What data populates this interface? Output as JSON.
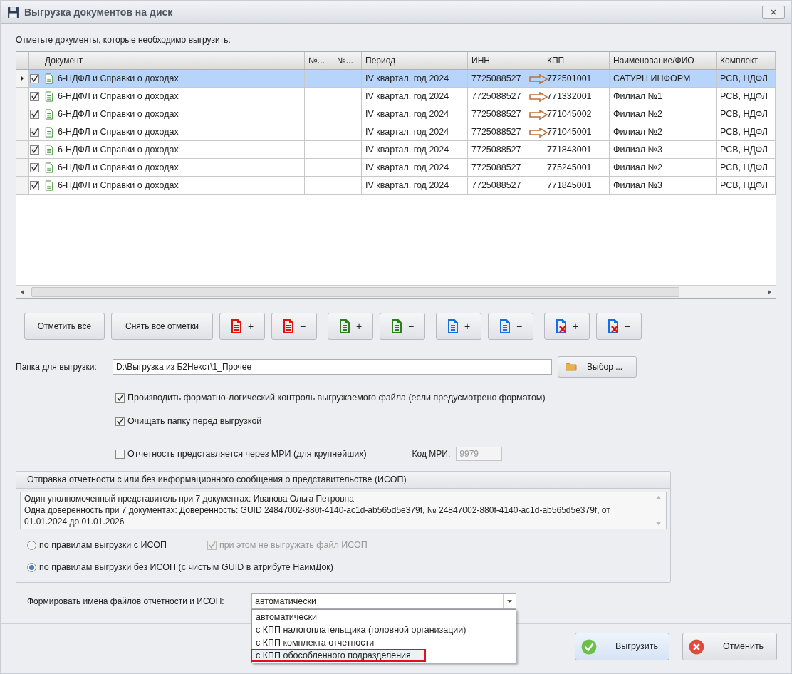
{
  "window": {
    "title": "Выгрузка документов на диск"
  },
  "prompt": "Отметьте документы, которые необходимо выгрузить:",
  "table": {
    "columns": [
      "Документ",
      "№...",
      "№...",
      "Период",
      "ИНН",
      "КПП",
      "Наименование/ФИО",
      "Комплект"
    ],
    "rows": [
      {
        "selected": true,
        "checked": true,
        "arrow": true,
        "cells": [
          "6-НДФЛ и Справки о доходах",
          "",
          "",
          "IV квартал, год 2024",
          "7725088527",
          "772501001",
          "САТУРН ИНФОРМ",
          "РСВ, НДФЛ"
        ]
      },
      {
        "selected": false,
        "checked": true,
        "arrow": true,
        "cells": [
          "6-НДФЛ и Справки о доходах",
          "",
          "",
          "IV квартал, год 2024",
          "7725088527",
          "771332001",
          "Филиал №1",
          "РСВ, НДФЛ"
        ]
      },
      {
        "selected": false,
        "checked": true,
        "arrow": true,
        "cells": [
          "6-НДФЛ и Справки о доходах",
          "",
          "",
          "IV квартал, год 2024",
          "7725088527",
          "771045002",
          "Филиал №2",
          "РСВ, НДФЛ"
        ]
      },
      {
        "selected": false,
        "checked": true,
        "arrow": true,
        "cells": [
          "6-НДФЛ и Справки о доходах",
          "",
          "",
          "IV квартал, год 2024",
          "7725088527",
          "771045001",
          "Филиал №2",
          "РСВ, НДФЛ"
        ]
      },
      {
        "selected": false,
        "checked": true,
        "arrow": false,
        "cells": [
          "6-НДФЛ и Справки о доходах",
          "",
          "",
          "IV квартал, год 2024",
          "7725088527",
          "771843001",
          "Филиал №3",
          "РСВ, НДФЛ"
        ]
      },
      {
        "selected": false,
        "checked": true,
        "arrow": false,
        "cells": [
          "6-НДФЛ и Справки о доходах",
          "",
          "",
          "IV квартал, год 2024",
          "7725088527",
          "775245001",
          "Филиал №2",
          "РСВ, НДФЛ"
        ]
      },
      {
        "selected": false,
        "checked": true,
        "arrow": false,
        "cells": [
          "6-НДФЛ и Справки о доходах",
          "",
          "",
          "IV квартал, год 2024",
          "7725088527",
          "771845001",
          "Филиал №3",
          "РСВ, НДФЛ"
        ]
      }
    ]
  },
  "buttons": [
    {
      "kind": "text",
      "label": "Отметить все"
    },
    {
      "kind": "text",
      "label": "Снять все отметки"
    },
    {
      "kind": "doc",
      "color": "#e01010",
      "sign": "+"
    },
    {
      "kind": "doc",
      "color": "#e01010",
      "sign": "−"
    },
    {
      "kind": "doc",
      "color": "#2e7d1e",
      "sign": "+"
    },
    {
      "kind": "doc",
      "color": "#2e7d1e",
      "sign": "−"
    },
    {
      "kind": "doc",
      "color": "#1a6fe0",
      "sign": "+"
    },
    {
      "kind": "doc",
      "color": "#1a6fe0",
      "sign": "−"
    },
    {
      "kind": "docx",
      "color": "#1a6fe0",
      "sign": "+"
    },
    {
      "kind": "docx",
      "color": "#1a6fe0",
      "sign": "−"
    }
  ],
  "folder": {
    "label": "Папка для выгрузки:",
    "value": "D:\\Выгрузка из Б2Некст\\1_Прочее",
    "button": "Выбор ..."
  },
  "options": [
    {
      "label": "Производить форматно-логический контроль выгружаемого файла (если предусмотрено форматом)",
      "checked": true
    },
    {
      "label": "Очищать папку перед выгрузкой",
      "checked": true
    },
    {
      "label": "Отчетность представляется через МРИ (для крупнейших)",
      "checked": false
    }
  ],
  "mri": {
    "label": "Код МРИ:",
    "value": "9979",
    "disabled": true
  },
  "isop": {
    "title": "Отправка отчетности с или без информационного сообщения о представительстве (ИСОП)",
    "lines": [
      "Один уполномоченный представитель при 7 документах: Иванова Ольга Петровна",
      "Одна доверенность при 7 документах: Доверенность: GUID 24847002-880f-4140-ac1d-ab565d5e379f, № 24847002-880f-4140-ac1d-ab565d5e379f, от 01.01.2024 до 01.01.2026"
    ],
    "radios": [
      {
        "label": "по правилам выгрузки с ИСОП",
        "selected": false
      },
      {
        "label": "по правилам выгрузки без ИСОП (с чистым GUID в атрибуте НаимДок)",
        "selected": true
      }
    ],
    "sub_option": {
      "label": "при этом не выгружать файл ИСОП",
      "checked": true,
      "disabled": true
    }
  },
  "naming": {
    "label": "Формировать имена файлов отчетности и ИСОП:",
    "value": "автоматически",
    "items": [
      {
        "label": "автоматически",
        "highlighted": false
      },
      {
        "label": "с КПП налогоплательщика (головной организации)",
        "highlighted": false
      },
      {
        "label": "с КПП комплекта отчетности",
        "highlighted": false
      },
      {
        "label": "с КПП обособленного подразделения",
        "highlighted": true
      }
    ]
  },
  "actions": [
    {
      "kind": "ok",
      "label": "Выгрузить"
    },
    {
      "kind": "cancel",
      "label": "Отменить"
    }
  ]
}
